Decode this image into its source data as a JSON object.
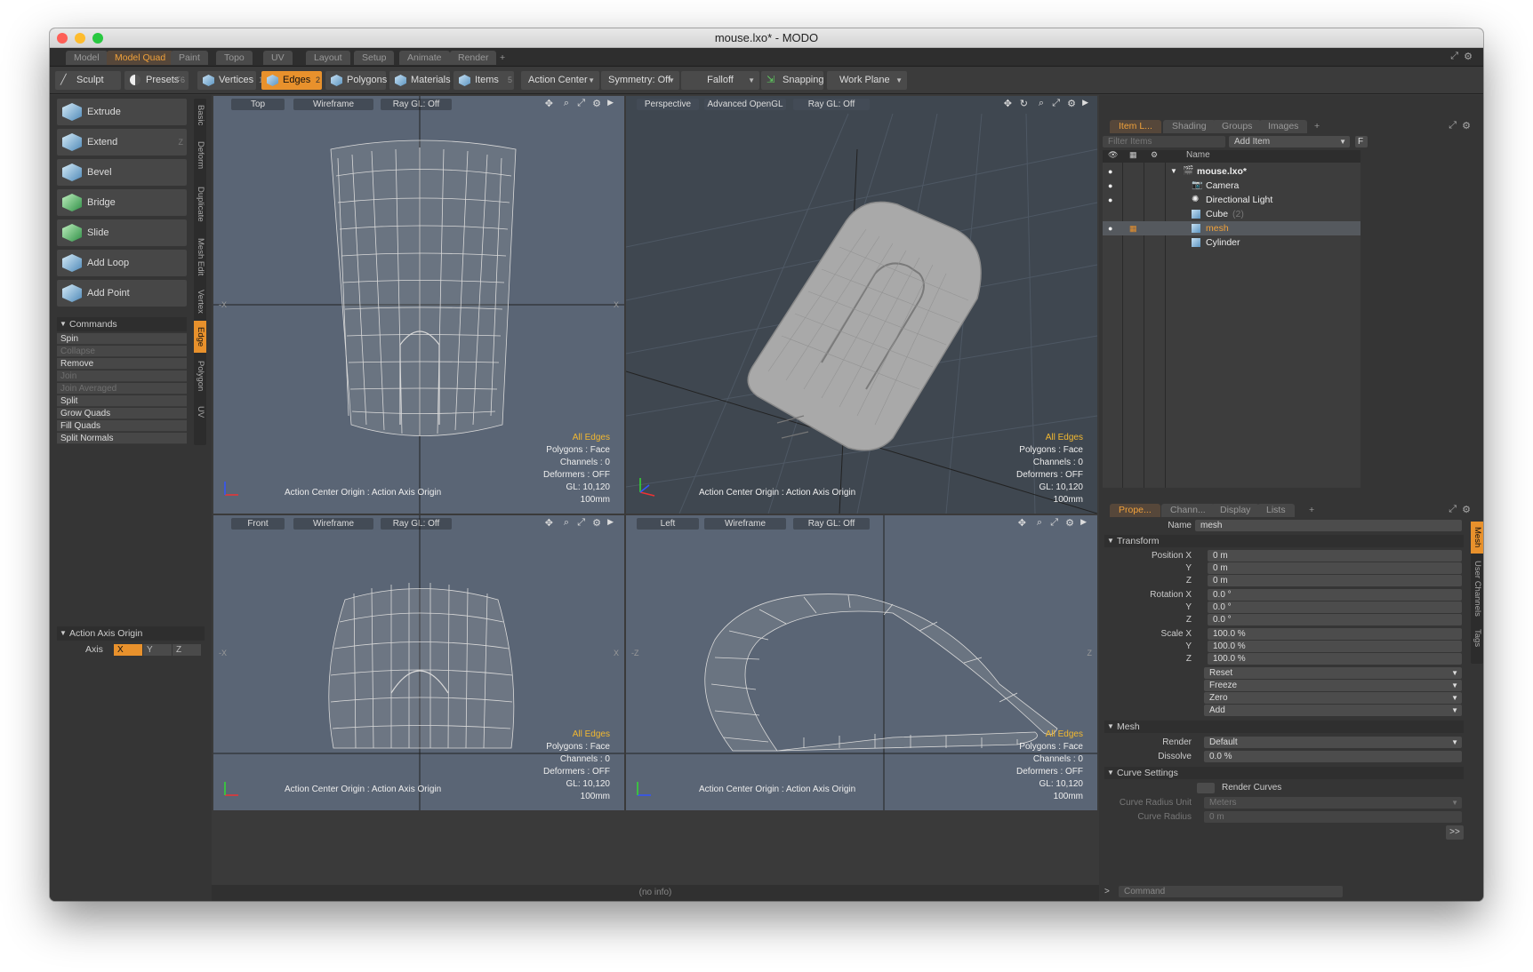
{
  "window": {
    "title": "mouse.lxo* - MODO"
  },
  "tabs": [
    "Model",
    "Model Quad",
    "Paint",
    "Topo",
    "UV",
    "Layout",
    "Setup",
    "Animate",
    "Render",
    "+"
  ],
  "toolbar": {
    "sculpt": "Sculpt",
    "presets": "Presets",
    "presets_key": "F6",
    "vertices": "Vertices",
    "vertices_count": "1",
    "edges": "Edges",
    "edges_count": "2",
    "polygons": "Polygons",
    "materials": "Materials",
    "items": "Items",
    "items_count": "5",
    "action_center": "Action Center",
    "symmetry": "Symmetry: Off",
    "falloff": "Falloff",
    "snapping": "Snapping",
    "work_plane": "Work Plane"
  },
  "left": {
    "tools": [
      {
        "label": "Extrude",
        "key": ""
      },
      {
        "label": "Extend",
        "key": "Z"
      },
      {
        "label": "Bevel",
        "key": ""
      },
      {
        "label": "Bridge",
        "key": ""
      },
      {
        "label": "Slide",
        "key": ""
      },
      {
        "label": "Add Loop",
        "key": ""
      },
      {
        "label": "Add Point",
        "key": ""
      }
    ],
    "vtabs": [
      "Basic",
      "Deform",
      "Duplicate",
      "Mesh Edit",
      "Vertex",
      "Edge",
      "Polygon",
      "UV"
    ],
    "commands_header": "Commands",
    "commands": [
      "Spin",
      "Collapse",
      "Remove",
      "Join",
      "Join Averaged",
      "Split",
      "Grow Quads",
      "Fill Quads",
      "Split Normals"
    ],
    "action_axis": "Action Axis Origin",
    "axis_label": "Axis",
    "axis": [
      "X",
      "Y",
      "Z"
    ]
  },
  "viewports": {
    "top": {
      "view": "Top",
      "shade": "Wireframe",
      "ray": "Ray GL: Off"
    },
    "persp": {
      "view": "Perspective",
      "shade": "Advanced OpenGL",
      "ray": "Ray GL: Off"
    },
    "front": {
      "view": "Front",
      "shade": "Wireframe",
      "ray": "Ray GL: Off"
    },
    "left": {
      "view": "Left",
      "shade": "Wireframe",
      "ray": "Ray GL: Off"
    },
    "stats": {
      "all_edges": "All Edges",
      "polygons": "Polygons : Face",
      "channels": "Channels : 0",
      "deformers": "Deformers : OFF",
      "gl": "GL: 10,120",
      "scale": "100mm"
    },
    "action_center": "Action Center Origin : Action Axis Origin",
    "axis_marks": [
      "X",
      "-X",
      "Z",
      "-Z",
      "Y"
    ]
  },
  "items": {
    "tabs": [
      "Item L...",
      "Shading",
      "Groups",
      "Images",
      "+"
    ],
    "filter_placeholder": "Filter Items",
    "add_item": "Add Item",
    "f": "F",
    "name_col": "Name",
    "tree": [
      {
        "name": "mouse.lxo*"
      },
      {
        "name": "Camera"
      },
      {
        "name": "Directional Light"
      },
      {
        "name": "Cube",
        "suffix": "(2)"
      },
      {
        "name": "mesh"
      },
      {
        "name": "Cylinder"
      }
    ]
  },
  "properties": {
    "tabs": [
      "Prope...",
      "Chann...",
      "Display",
      "Lists",
      "+"
    ],
    "name_label": "Name",
    "name_value": "mesh",
    "transform": "Transform",
    "position_label": "Position X",
    "rotation_label": "Rotation X",
    "scale_label": "Scale X",
    "y": "Y",
    "z": "Z",
    "position": [
      "0 m",
      "0 m",
      "0 m"
    ],
    "rotation": [
      "0.0 °",
      "0.0 °",
      "0.0 °"
    ],
    "scale": [
      "100.0 %",
      "100.0 %",
      "100.0 %"
    ],
    "actions": [
      "Reset",
      "Freeze",
      "Zero",
      "Add"
    ],
    "mesh": "Mesh",
    "render_label": "Render",
    "render_value": "Default",
    "dissolve_label": "Dissolve",
    "dissolve_value": "0.0 %",
    "curve_settings": "Curve Settings",
    "render_curves": "Render Curves",
    "curve_radius_unit_label": "Curve Radius Unit",
    "curve_radius_unit_value": "Meters",
    "curve_radius_label": "Curve Radius",
    "curve_radius_value": "0 m",
    "more": ">>",
    "side_tabs": [
      "Mesh",
      "User Channels",
      "Tags"
    ]
  },
  "status": {
    "info": "(no info)",
    "command_prompt": ">",
    "command_placeholder": "Command"
  },
  "colors": {
    "accent": "#e8912c",
    "viewport": "#5a6575",
    "viewport_persp": "#3f4750",
    "panel": "#353535",
    "stat_yellow": "#f2b830"
  }
}
